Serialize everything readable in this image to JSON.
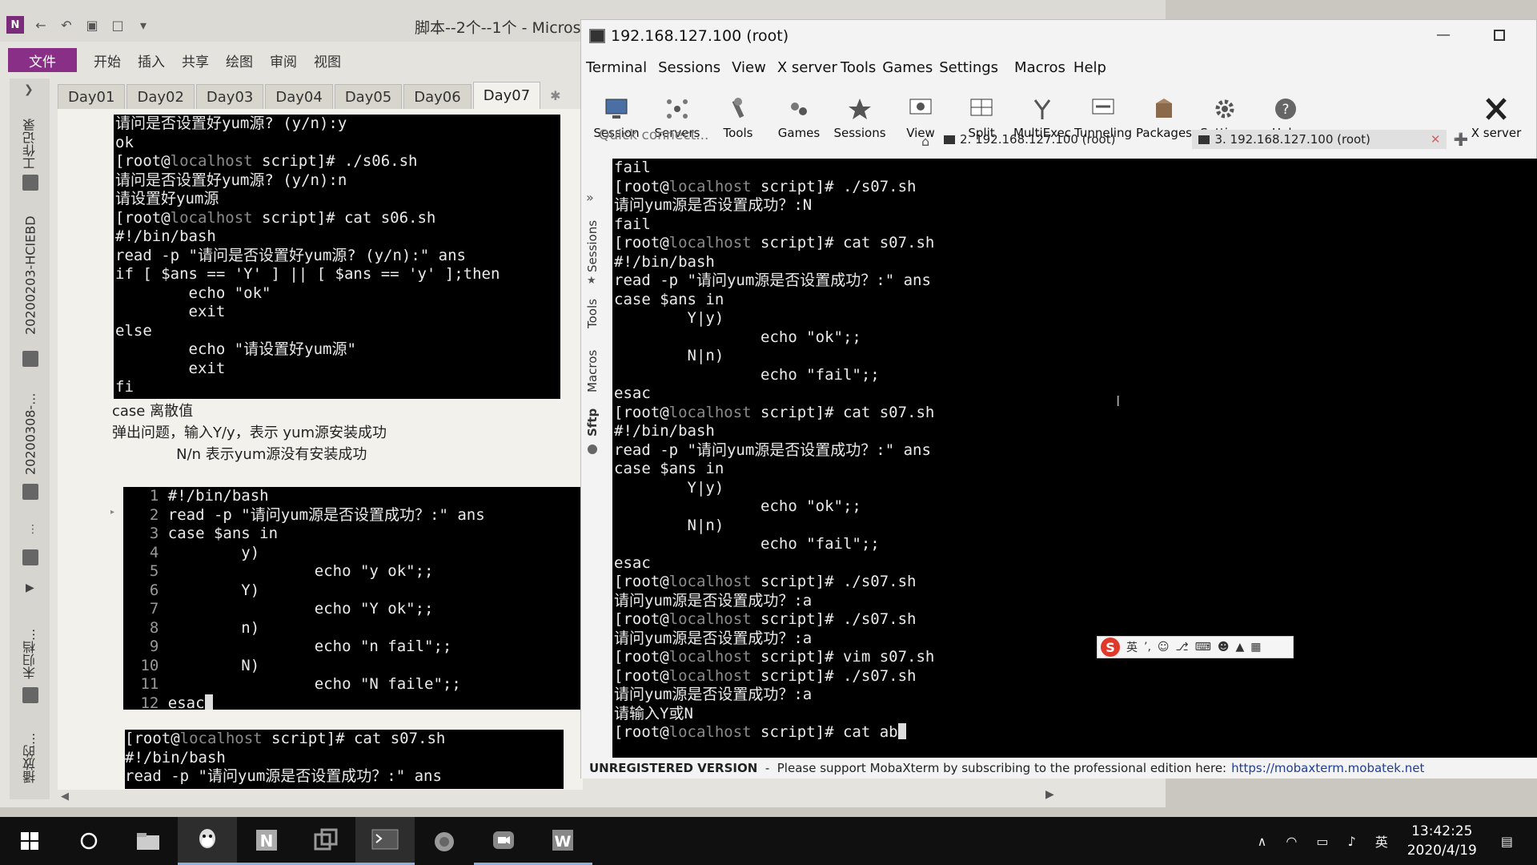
{
  "onenote": {
    "title": "脚本--2个--1个 - Micros",
    "ribbon": {
      "file": "文件",
      "tabs": [
        "开始",
        "插入",
        "共享",
        "绘图",
        "审阅",
        "视图"
      ]
    },
    "side_tabs": [
      "工作记录",
      "20200203-HCIEBD",
      "20200308-...",
      "未归档...",
      "播放的..."
    ],
    "page_tabs": [
      "Day01",
      "Day02",
      "Day03",
      "Day04",
      "Day05",
      "Day06",
      "Day07"
    ],
    "active_page_tab": "Day07",
    "term1_lines": [
      "请问是否设置好yum源? (y/n):y",
      "ok",
      "[root@localhost script]# ./s06.sh",
      "请问是否设置好yum源? (y/n):n",
      "请设置好yum源",
      "[root@localhost script]# cat s06.sh",
      "#!/bin/bash",
      "read -p \"请问是否设置好yum源? (y/n):\" ans",
      "if [ $ans == 'Y' ] || [ $ans == 'y' ];then",
      "        echo \"ok\"",
      "        exit",
      "else",
      "        echo \"请设置好yum源\"",
      "        exit",
      "fi"
    ],
    "note_lines": [
      "case  离散值",
      "弹出问题，输入Y/y，表示 yum源安装成功",
      "              N/n 表示yum源没有安装成功"
    ],
    "vim_lines": [
      {
        "n": "1",
        "code": "#!/bin/bash"
      },
      {
        "n": "2",
        "code": "read -p \"请问yum源是否设置成功？:\" ans"
      },
      {
        "n": "3",
        "code": "case $ans in"
      },
      {
        "n": "4",
        "code": "        y)"
      },
      {
        "n": "5",
        "code": "                echo \"y ok\";;"
      },
      {
        "n": "6",
        "code": "        Y)"
      },
      {
        "n": "7",
        "code": "                echo \"Y ok\";;"
      },
      {
        "n": "8",
        "code": "        n)"
      },
      {
        "n": "9",
        "code": "                echo \"n fail\";;"
      },
      {
        "n": "10",
        "code": "        N)"
      },
      {
        "n": "11",
        "code": "                echo \"N faile\";;"
      },
      {
        "n": "12",
        "code": "esac"
      }
    ],
    "term3_lines": [
      "[root@localhost script]# cat s07.sh",
      "#!/bin/bash",
      "read -p \"请问yum源是否设置成功？:\" ans"
    ]
  },
  "moba": {
    "title": "192.168.127.100 (root)",
    "menu": [
      "Terminal",
      "Sessions",
      "View",
      "X server",
      "Tools",
      "Games",
      "Settings",
      "Macros",
      "Help"
    ],
    "toolbar": [
      "Session",
      "Servers",
      "Tools",
      "Games",
      "Sessions",
      "View",
      "Split",
      "MultiExec",
      "Tunneling",
      "Packages",
      "Settings",
      "Help"
    ],
    "xserver_label": "X server",
    "quick_connect_placeholder": "Quick connect...",
    "session_tabs": [
      "2. 192.168.127.100 (root)",
      "3. 192.168.127.100 (root)"
    ],
    "side_tabs": [
      "Sessions",
      "Tools",
      "Macros",
      "Sftp"
    ],
    "terminal_lines": [
      "fail",
      "[root@localhost script]# ./s07.sh",
      "请问yum源是否设置成功？:N",
      "fail",
      "[root@localhost script]# cat s07.sh",
      "#!/bin/bash",
      "read -p \"请问yum源是否设置成功？:\" ans",
      "case $ans in",
      "        Y|y)",
      "                echo \"ok\";;",
      "        N|n)",
      "                echo \"fail\";;",
      "esac",
      "[root@localhost script]# cat s07.sh",
      "#!/bin/bash",
      "read -p \"请问yum源是否设置成功？:\" ans",
      "case $ans in",
      "        Y|y)",
      "                echo \"ok\";;",
      "        N|n)",
      "                echo \"fail\";;",
      "esac",
      "[root@localhost script]# ./s07.sh",
      "请问yum源是否设置成功？:a",
      "[root@localhost script]# ./s07.sh",
      "请问yum源是否设置成功？:a",
      "[root@localhost script]# vim s07.sh",
      "[root@localhost script]# ./s07.sh",
      "请问yum源是否设置成功？:a",
      "请输入Y或N",
      "[root@localhost script]# cat ab"
    ],
    "status_bold": "UNREGISTERED VERSION",
    "status_text": "  -  Please support MobaXterm by subscribing to the professional edition here:",
    "status_link": "https://mobaxterm.mobatek.net",
    "ime_label": "英"
  },
  "taskbar": {
    "tray_lang": "英",
    "time": "13:42:25",
    "date": "2020/4/19"
  },
  "colors": {
    "onenote_file": "#8a2f88",
    "terminal_bg": "#000000",
    "taskbar_bg": "#101010",
    "link": "#1d3e9c"
  }
}
